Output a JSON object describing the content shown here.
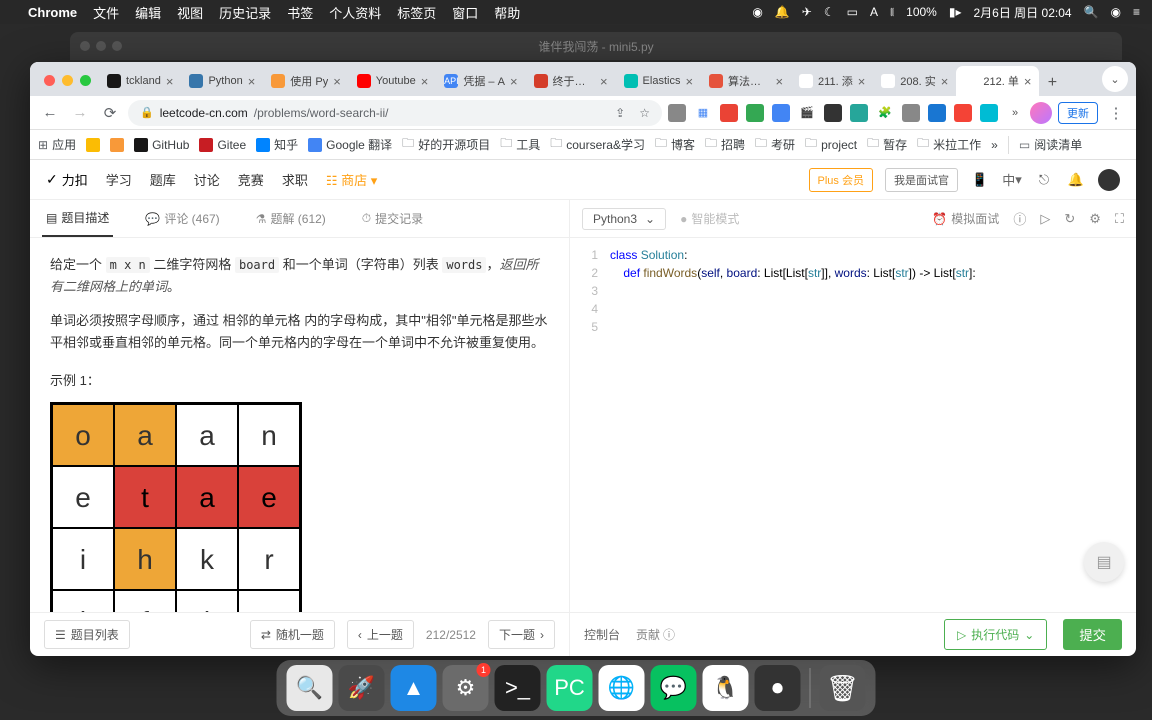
{
  "menubar": {
    "app": "Chrome",
    "items": [
      "文件",
      "编辑",
      "视图",
      "历史记录",
      "书签",
      "个人资料",
      "标签页",
      "窗口",
      "帮助"
    ],
    "battery": "100%",
    "date": "2月6日 周日 02:04"
  },
  "bgwindow": {
    "title": "谁伴我闯荡 - mini5.py"
  },
  "tabs": [
    {
      "title": "tckland",
      "ico": "#181717"
    },
    {
      "title": "Python",
      "ico": "#3776ab"
    },
    {
      "title": "使用 Py",
      "ico": "#f89939"
    },
    {
      "title": "Youtube",
      "ico": "#ff0000"
    },
    {
      "title": "凭据 – A",
      "ico": "#4285f4",
      "badge": "API"
    },
    {
      "title": "终于有人",
      "ico": "#d43d2a"
    },
    {
      "title": "Elastics",
      "ico": "#00bfb3"
    },
    {
      "title": "算法知识",
      "ico": "#e5533c"
    },
    {
      "title": "211. 添",
      "ico": "#fff"
    },
    {
      "title": "208. 实",
      "ico": "#fff"
    },
    {
      "title": "212. 单",
      "ico": "#fff",
      "active": true
    }
  ],
  "url": {
    "domain": "leetcode-cn.com",
    "path": "/problems/word-search-ii/"
  },
  "updateBtn": "更新",
  "bookmarks": {
    "apps": "应用",
    "items": [
      {
        "label": "",
        "ico": "#fbbc04"
      },
      {
        "label": "",
        "ico": "#f89939"
      },
      {
        "label": "GitHub",
        "ico": "#181717"
      },
      {
        "label": "Gitee",
        "ico": "#c71d23"
      },
      {
        "label": "知乎",
        "ico": "#0084ff"
      },
      {
        "label": "Google 翻译",
        "ico": "#4285f4"
      }
    ],
    "folders": [
      "好的开源项目",
      "工具",
      "coursera&学习",
      "博客",
      "招聘",
      "考研",
      "project",
      "暂存",
      "米拉工作"
    ],
    "more": "»",
    "readlist": "阅读清单"
  },
  "lcnav": {
    "logo": "力扣",
    "items": [
      "学习",
      "题库",
      "讨论",
      "竞赛",
      "求职"
    ],
    "store": "商店",
    "plus": "Plus 会员",
    "interviewer": "我是面试官",
    "lang": "中"
  },
  "lctabs": {
    "desc": "题目描述",
    "comments": "评论 (467)",
    "solutions": "题解 (612)",
    "submissions": "提交记录"
  },
  "problem": {
    "p1a": "给定一个 ",
    "p1b": " 二维字符网格 ",
    "p1c": " 和一个单词（字符串）列表 ",
    "p1d": "，",
    "p1e": "返回所有二维网格上的单词",
    "p1f": "。",
    "mxn": "m x n",
    "board": "board",
    "words": "words",
    "p2": "单词必须按照字母顺序，通过 相邻的单元格 内的字母构成，其中\"相邻\"单元格是那些水平相邻或垂直相邻的单元格。同一个单元格内的字母在一个单词中不允许被重复使用。",
    "example1": "示例 1：",
    "grid": [
      [
        {
          "c": "o",
          "cls": "gc-orange"
        },
        {
          "c": "a",
          "cls": "gc-orange"
        },
        {
          "c": "a",
          "cls": "gc-white"
        },
        {
          "c": "n",
          "cls": "gc-white"
        }
      ],
      [
        {
          "c": "e",
          "cls": "gc-white"
        },
        {
          "c": "t",
          "cls": "gc-red"
        },
        {
          "c": "a",
          "cls": "gc-red"
        },
        {
          "c": "e",
          "cls": "gc-red"
        }
      ],
      [
        {
          "c": "i",
          "cls": "gc-white"
        },
        {
          "c": "h",
          "cls": "gc-orange"
        },
        {
          "c": "k",
          "cls": "gc-white"
        },
        {
          "c": "r",
          "cls": "gc-white"
        }
      ],
      [
        {
          "c": "i",
          "cls": "gc-white"
        },
        {
          "c": "f",
          "cls": "gc-white"
        },
        {
          "c": "l",
          "cls": "gc-white"
        },
        {
          "c": "v",
          "cls": "gc-white"
        }
      ]
    ]
  },
  "leftBottom": {
    "list": "题目列表",
    "random": "随机一题",
    "prev": "上一题",
    "counter": "212/2512",
    "next": "下一题"
  },
  "editor": {
    "lang": "Python3",
    "smart": "智能模式",
    "mock": "模拟面试",
    "lines": [
      {
        "n": "1",
        "html": "<span class='kw'>class</span> <span class='cls'>Solution</span>:"
      },
      {
        "n": "2",
        "html": "    <span class='kw'>def</span> <span class='fn'>findWords</span>(<span class='param'>self</span>, <span class='param'>board</span>: List[List[<span class='typ'>str</span>]], <span class='param'>words</span>: List[<span class='typ'>str</span>]) -> List[<span class='typ'>str</span>]:"
      },
      {
        "n": "3",
        "html": ""
      },
      {
        "n": "4",
        "html": ""
      },
      {
        "n": "5",
        "html": ""
      }
    ]
  },
  "rightBottom": {
    "console": "控制台",
    "contrib": "贡献",
    "run": "执行代码",
    "submit": "提交"
  },
  "dock": [
    {
      "bg": "#e8e8e8",
      "icon": "🔍"
    },
    {
      "bg": "#4a4a4a",
      "icon": "🚀"
    },
    {
      "bg": "#1e88e5",
      "icon": "▲"
    },
    {
      "bg": "#6b6b6b",
      "icon": "⚙",
      "badge": "1"
    },
    {
      "bg": "#222",
      "icon": ">_"
    },
    {
      "bg": "#21d789",
      "icon": "PC"
    },
    {
      "bg": "#fff",
      "icon": "🌐"
    },
    {
      "bg": "#07c160",
      "icon": "💬"
    },
    {
      "bg": "#fff",
      "icon": "🐧"
    },
    {
      "bg": "#333",
      "icon": "⏺"
    }
  ],
  "trash": "🗑"
}
